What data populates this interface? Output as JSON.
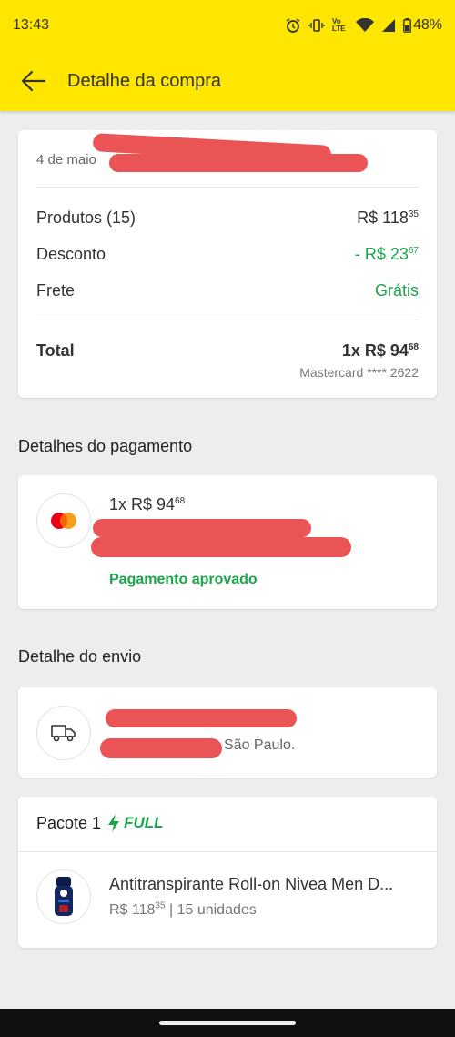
{
  "status": {
    "time": "13:43",
    "battery": "48%",
    "network": "Vo LTE"
  },
  "header": {
    "title": "Detalhe da compra"
  },
  "summary": {
    "date": "4 de maio",
    "products_label": "Produtos (15)",
    "products_value": "R$ 118",
    "products_cents": "35",
    "discount_label": "Desconto",
    "discount_value": "- R$ 23",
    "discount_cents": "67",
    "shipping_label": "Frete",
    "shipping_value": "Grátis",
    "total_label": "Total",
    "total_value": "1x R$ 94",
    "total_cents": "68",
    "card_info": "Mastercard **** 2622"
  },
  "payment": {
    "section_title": "Detalhes do pagamento",
    "amount": "1x R$ 94",
    "amount_cents": "68",
    "status": "Pagamento aprovado"
  },
  "shipping": {
    "section_title": "Detalhe do envio",
    "city": "São Paulo."
  },
  "package": {
    "title": "Pacote 1",
    "badge": "FULL",
    "product_name": "Antitranspirante Roll-on Nivea Men D...",
    "price": "R$ 118",
    "price_cents": "35",
    "quantity": "| 15 unidades"
  },
  "colors": {
    "brand_yellow": "#fee600",
    "success_green": "#1aa54b",
    "redaction": "#ea5455"
  }
}
